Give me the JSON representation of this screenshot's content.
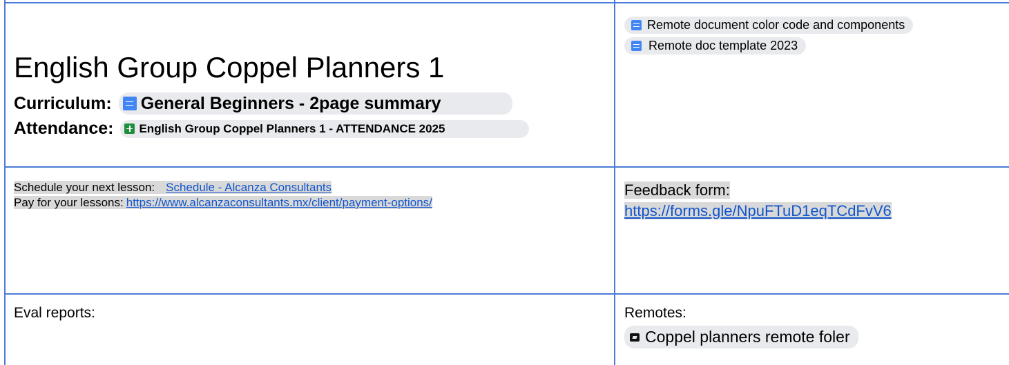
{
  "top_left": {
    "title": "English Group Coppel Planners 1",
    "curriculum_label": "Curriculum:",
    "curriculum_chip": "General Beginners - 2page summary",
    "attendance_label": "Attendance:",
    "attendance_chip": "English Group Coppel Planners 1 - ATTENDANCE 2025"
  },
  "top_right": {
    "chips": [
      {
        "label": "Remote document color code and components",
        "icon": "doc-icon"
      },
      {
        "label": "Remote doc template 2023",
        "icon": "doc-icon"
      }
    ]
  },
  "middle_left": {
    "schedule_label": "Schedule your next lesson:",
    "schedule_link": "Schedule - Alcanza Consultants",
    "pay_label": "Pay for your lessons:",
    "pay_link": "https://www.alcanzaconsultants.mx/client/payment-options/"
  },
  "middle_right": {
    "feedback_label": "Feedback form:",
    "feedback_link": "https://forms.gle/NpuFTuD1eqTCdFvV6"
  },
  "bottom_left": {
    "eval_label": "Eval reports:"
  },
  "bottom_right": {
    "remotes_label": "Remotes:",
    "folder_chip": "Coppel planners remote foler",
    "folder_icon": "folder-icon"
  },
  "colors": {
    "border": "#4a7bd6",
    "link": "#1155cc",
    "chip": "#e8eaed",
    "highlight": "#d9d9d9"
  }
}
